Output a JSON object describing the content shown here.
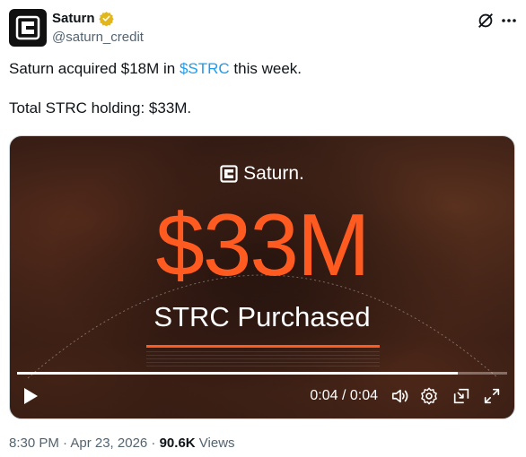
{
  "author": {
    "display_name": "Saturn",
    "handle": "@saturn_credit",
    "avatar_icon": "saturn-logo-icon",
    "verified_badge_color": "#e2b719"
  },
  "tweet": {
    "line1_prefix": "Saturn acquired $18M in ",
    "line1_hashtag": "$STRC",
    "line1_suffix": " this week.",
    "line2": "Total STRC holding: $33M."
  },
  "media": {
    "logo_text": "Saturn.",
    "amount": "$33M",
    "subtitle": "STRC Purchased",
    "progress": 0.9,
    "time": "0:04 / 0:04",
    "accent_color": "#ff5a1f"
  },
  "footer": {
    "timestamp": "8:30 PM · Apr 23, 2026 · ",
    "views_count": "90.6K",
    "views_label": " Views"
  },
  "colors": {
    "link": "#1d9bf0",
    "secondary_text": "#536471",
    "primary_text": "#0f1419"
  }
}
